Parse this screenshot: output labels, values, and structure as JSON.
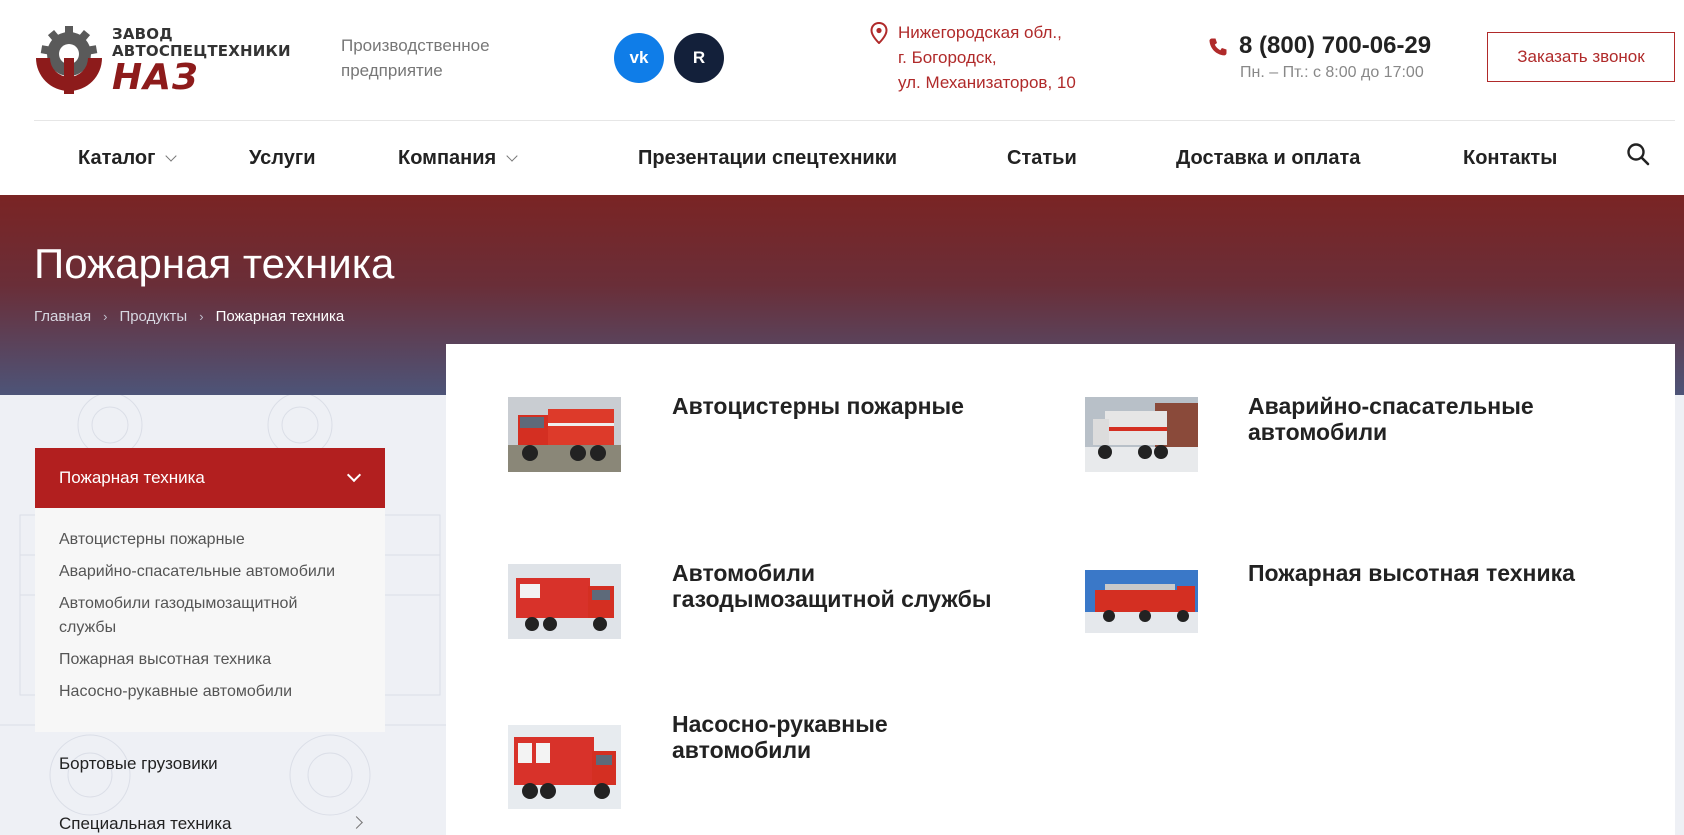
{
  "header": {
    "logo": {
      "line1": "ЗАВОД",
      "line2": "АВТОСПЕЦТЕХНИКИ",
      "brand": "НАЗ"
    },
    "tagline": "Производственное предприятие",
    "social": [
      {
        "name": "vk",
        "glyph": "vk"
      },
      {
        "name": "rutube",
        "glyph": "R"
      }
    ],
    "address": [
      "Нижегородская обл.,",
      "г. Богородск,",
      "ул. Механизаторов, 10"
    ],
    "phone": "8 (800) 700-06-29",
    "hours": "Пн. – Пт.: с 8:00 до 17:00",
    "callback_label": "Заказать звонок"
  },
  "nav": {
    "items": [
      {
        "label": "Каталог",
        "dropdown": true
      },
      {
        "label": "Услуги",
        "dropdown": false
      },
      {
        "label": "Компания",
        "dropdown": true
      },
      {
        "label": "Презентации спецтехники",
        "dropdown": false
      },
      {
        "label": "Статьи",
        "dropdown": false
      },
      {
        "label": "Доставка и оплата",
        "dropdown": false
      },
      {
        "label": "Контакты",
        "dropdown": false
      }
    ],
    "search_icon": "search-icon"
  },
  "banner": {
    "title": "Пожарная техника",
    "breadcrumb": [
      "Главная",
      "Продукты",
      "Пожарная техника"
    ]
  },
  "sidebar": {
    "active": "Пожарная техника",
    "subitems": [
      "Автоцистерны пожарные",
      "Аварийно-спасательные автомобили",
      "Автомобили газодымозащитной службы",
      "Пожарная высотная техника",
      "Насосно-рукавные автомобили"
    ],
    "others": [
      "Бортовые грузовики",
      "Специальная техника"
    ]
  },
  "categories": [
    {
      "title": "Автоцистерны пожарные"
    },
    {
      "title": "Аварийно-спасательные автомобили"
    },
    {
      "title": "Автомобили газодымозащитной службы"
    },
    {
      "title": "Пожарная высотная техника"
    },
    {
      "title": "Насосно-рукавные автомобили"
    }
  ],
  "colors": {
    "brand_red": "#b21f1f",
    "banner_top": "#7a2424",
    "banner_bottom": "#4d5478",
    "vk_blue": "#0f7de8",
    "rutube_dark": "#13203a"
  }
}
